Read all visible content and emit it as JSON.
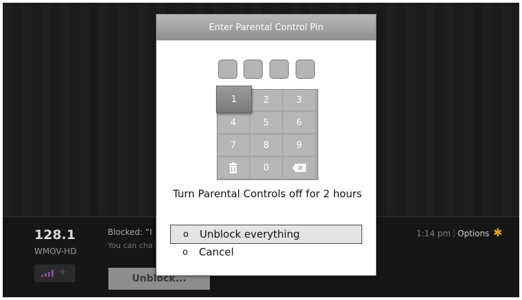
{
  "channel": {
    "number": "128.1",
    "name": "WMOV-HD",
    "blocked_text": "Blocked: “I",
    "blocked_sub": "You can cha",
    "unblock_button": "Unblock..."
  },
  "status": {
    "time": "1:14 pm",
    "separator": "|",
    "options_label": "Options",
    "options_icon": "asterisk-icon",
    "accent_color": "#e2a500"
  },
  "dialog": {
    "title": "Enter Parental Control Pin",
    "pin_slots": 4,
    "keys": [
      "1",
      "2",
      "3",
      "4",
      "5",
      "6",
      "7",
      "8",
      "9",
      "delete-icon",
      "0",
      "backspace-icon"
    ],
    "focused_key": "1",
    "message": "Turn Parental Controls off for 2 hours",
    "options": [
      {
        "radio": "o",
        "label": "Unblock everything",
        "selected": true
      },
      {
        "radio": "o",
        "label": "Cancel",
        "selected": false
      }
    ]
  }
}
